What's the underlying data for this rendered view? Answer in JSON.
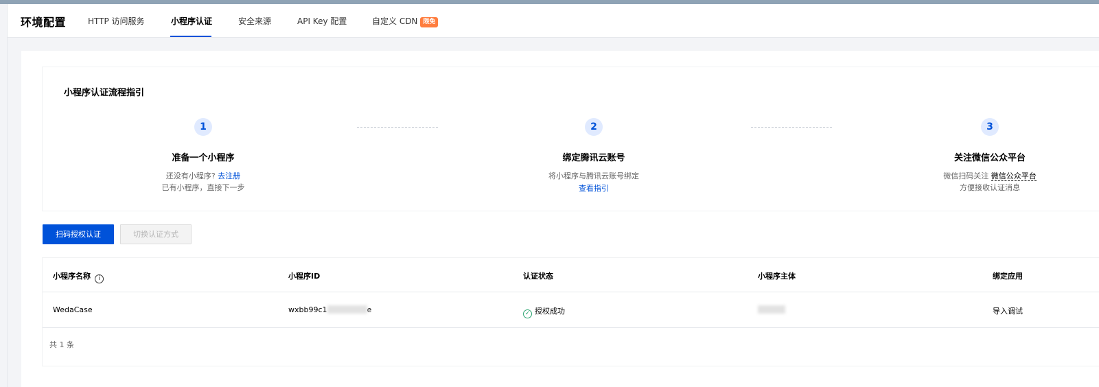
{
  "header": {
    "title": "环境配置",
    "tabs": [
      {
        "label": "HTTP 访问服务"
      },
      {
        "label": "小程序认证"
      },
      {
        "label": "安全来源"
      },
      {
        "label": "API Key 配置"
      },
      {
        "label": "自定义 CDN",
        "badge": "限免"
      }
    ]
  },
  "guide": {
    "title": "小程序认证流程指引",
    "steps": [
      {
        "number": "1",
        "title": "准备一个小程序",
        "line1": "还没有小程序?",
        "line1_link": "去注册",
        "line2": "已有小程序，直接下一步"
      },
      {
        "number": "2",
        "title": "绑定腾讯云账号",
        "line1": "将小程序与腾讯云账号绑定",
        "link": "查看指引"
      },
      {
        "number": "3",
        "title": "关注微信公众平台",
        "line1": "微信扫码关注",
        "line1_term": "微信公众平台",
        "line2": "方便接收认证消息"
      }
    ]
  },
  "actions": {
    "scan_auth": "扫码授权认证",
    "switch_auth": "切换认证方式"
  },
  "table": {
    "columns": [
      "小程序名称",
      "小程序ID",
      "认证状态",
      "小程序主体",
      "绑定应用"
    ],
    "rows": [
      {
        "name": "WedaCase",
        "id_prefix": "wxbb99c1",
        "id_suffix": "e",
        "status": "授权成功",
        "action": "导入调试"
      }
    ],
    "total": "共 1 条"
  },
  "icons": {
    "info": "info-circle-icon",
    "check": "check-circle-icon"
  },
  "colors": {
    "primary": "#0052d9",
    "success": "#2ba471",
    "badge": "#ff7d3e"
  }
}
